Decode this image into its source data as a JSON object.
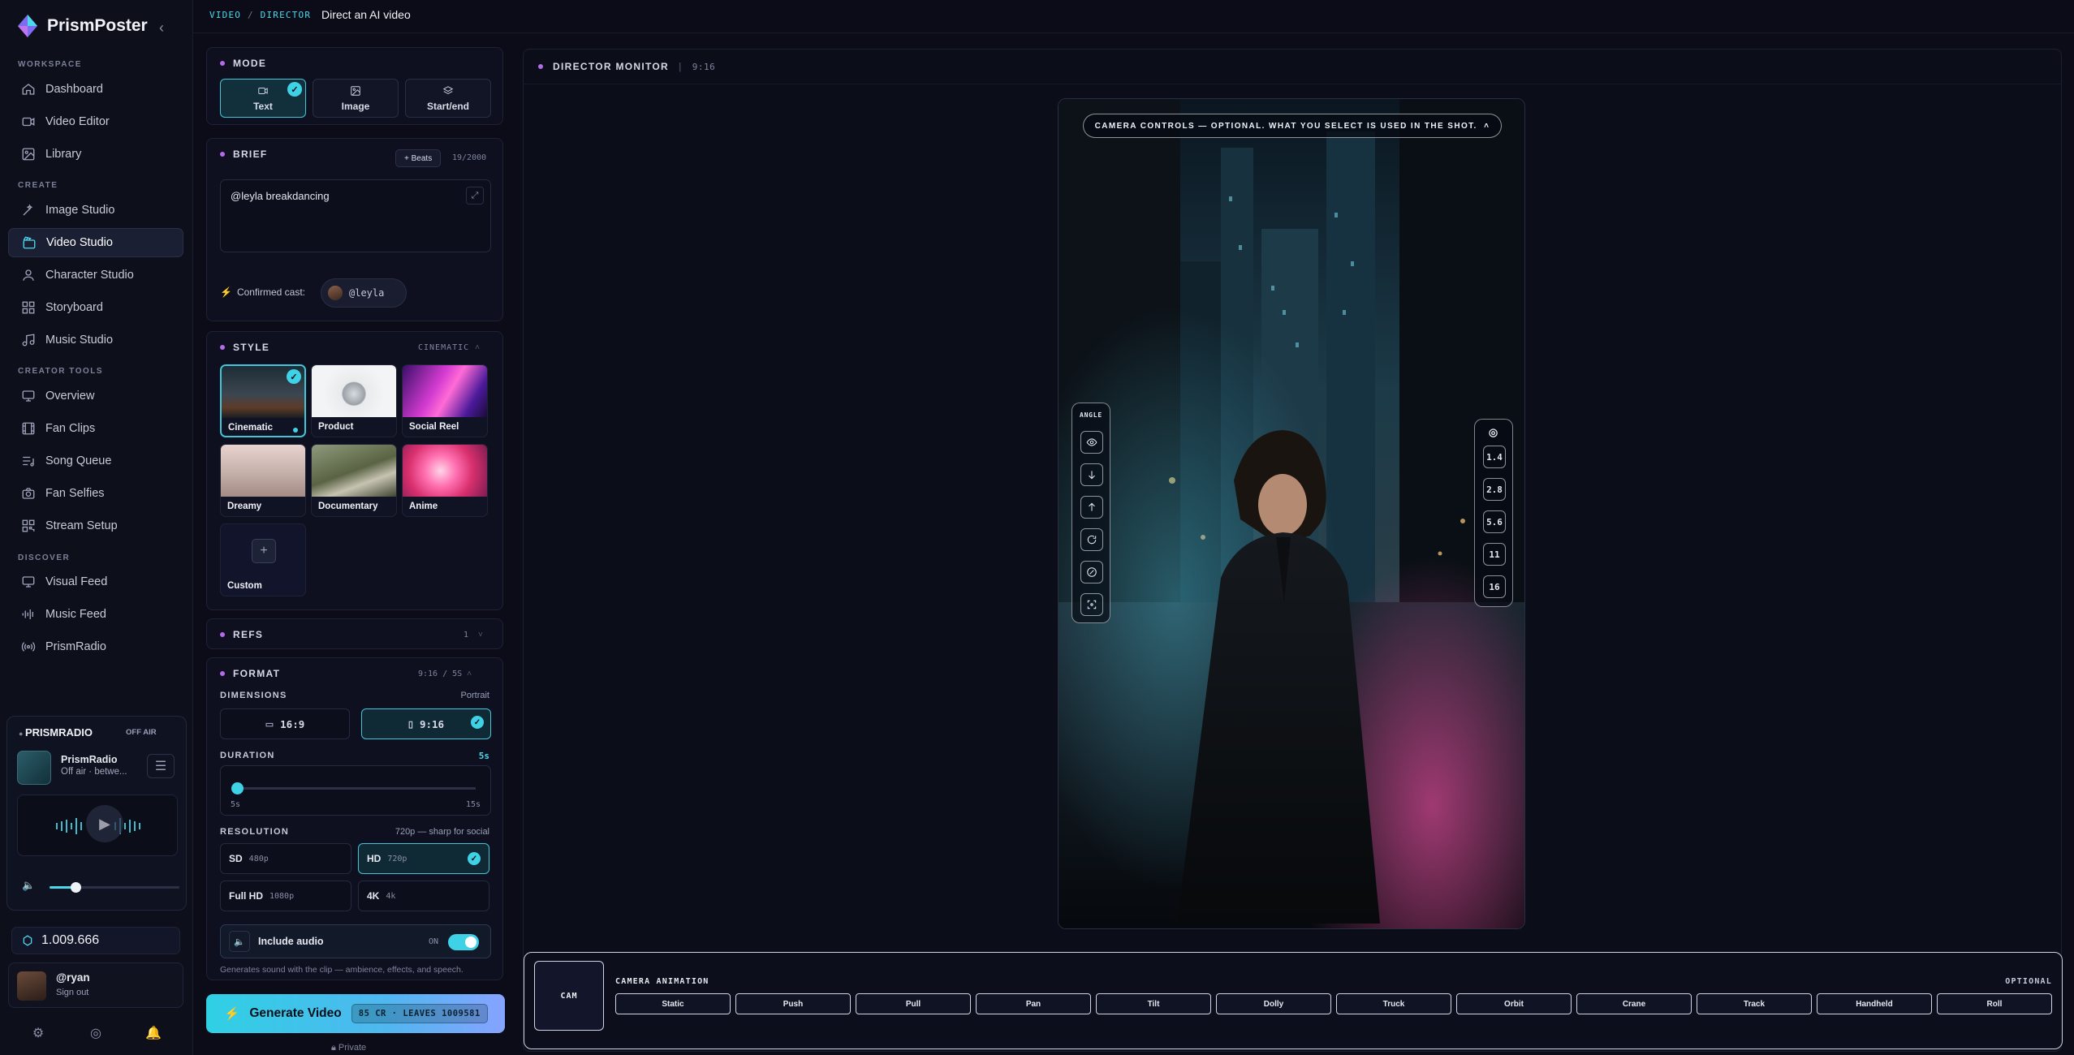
{
  "app": {
    "name": "PrismPoster"
  },
  "breadcrumb": {
    "section": "VIDEO",
    "sep": "/",
    "page": "DIRECTOR",
    "title": "Direct an AI video"
  },
  "sidebar": {
    "sections": {
      "workspace": "WORKSPACE",
      "create": "CREATE",
      "creator_tools": "CREATOR TOOLS",
      "discover": "DISCOVER"
    },
    "items": [
      {
        "label": "Dashboard",
        "icon": "home-icon"
      },
      {
        "label": "Video Editor",
        "icon": "video-icon"
      },
      {
        "label": "Library",
        "icon": "image-icon"
      },
      {
        "label": "Image Studio",
        "icon": "wand-icon"
      },
      {
        "label": "Video Studio",
        "icon": "clapperboard-icon",
        "active": true
      },
      {
        "label": "Character Studio",
        "icon": "user-icon"
      },
      {
        "label": "Storyboard",
        "icon": "grid-icon"
      },
      {
        "label": "Music Studio",
        "icon": "music-icon"
      },
      {
        "label": "Overview",
        "icon": "monitor-icon"
      },
      {
        "label": "Fan Clips",
        "icon": "film-icon"
      },
      {
        "label": "Song Queue",
        "icon": "list-music-icon"
      },
      {
        "label": "Fan Selfies",
        "icon": "camera-icon"
      },
      {
        "label": "Stream Setup",
        "icon": "qr-icon"
      },
      {
        "label": "Visual Feed",
        "icon": "monitor-icon"
      },
      {
        "label": "Music Feed",
        "icon": "waveform-icon"
      },
      {
        "label": "PrismRadio",
        "icon": "radio-icon"
      }
    ],
    "radio": {
      "title": "PRISMRADIO",
      "status": "OFF AIR",
      "station": "PrismRadio",
      "subtitle": "Off air · betwe...",
      "volume": 0.2
    },
    "credits": "1.009.666",
    "user": {
      "name": "@ryan",
      "action": "Sign out"
    }
  },
  "mode": {
    "title": "MODE",
    "options": [
      {
        "label": "Text",
        "selected": true
      },
      {
        "label": "Image"
      },
      {
        "label": "Start/end"
      }
    ]
  },
  "brief": {
    "title": "BRIEF",
    "beats_label": "+ Beats",
    "count": "19/2000",
    "text": "@leyla breakdancing",
    "cast_label": "Confirmed cast:",
    "cast_chip": "@leyla"
  },
  "style": {
    "title": "STYLE",
    "selected_name": "CINEMATIC",
    "tiles": [
      {
        "label": "Cinematic",
        "selected": true
      },
      {
        "label": "Product"
      },
      {
        "label": "Social Reel"
      },
      {
        "label": "Dreamy"
      },
      {
        "label": "Documentary"
      },
      {
        "label": "Anime"
      },
      {
        "label": "Custom"
      }
    ]
  },
  "refs": {
    "title": "REFS",
    "count": "1"
  },
  "format": {
    "title": "FORMAT",
    "summary": "9:16 / 5S",
    "dimensions_label": "DIMENSIONS",
    "orientation": "Portrait",
    "dimensions": [
      {
        "label": "16:9"
      },
      {
        "label": "9:16",
        "selected": true
      }
    ],
    "duration_label": "DURATION",
    "duration_value": "5s",
    "duration_min": "5s",
    "duration_max": "15s",
    "duration_fraction": 0,
    "resolution_label": "RESOLUTION",
    "resolution_note": "720p — sharp for social",
    "resolutions": [
      {
        "label": "SD",
        "px": "480p"
      },
      {
        "label": "HD",
        "px": "720p",
        "selected": true
      },
      {
        "label": "Full HD",
        "px": "1080p"
      },
      {
        "label": "4K",
        "px": "4k"
      }
    ],
    "audio_label": "Include audio",
    "audio_state": "ON",
    "audio_note": "Generates sound with the clip — ambience, effects, and speech."
  },
  "generate": {
    "label": "Generate Video",
    "cost": "85 CR · LEAVES 1009581",
    "visibility": "Private"
  },
  "monitor": {
    "title": "DIRECTOR MONITOR",
    "ratio": "9:16",
    "camera_controls": "CAMERA CONTROLS — OPTIONAL. WHAT YOU SELECT IS USED IN THE SHOT.",
    "angle_label": "ANGLE",
    "angles": [
      "eye-level-icon",
      "low-angle-icon",
      "high-angle-icon",
      "rotate-icon",
      "dutch-angle-icon",
      "focus-icon"
    ],
    "apertures": [
      "1.4",
      "2.8",
      "5.6",
      "11",
      "16"
    ]
  },
  "animation": {
    "cam_label": "CAM",
    "title": "CAMERA ANIMATION",
    "optional": "OPTIONAL",
    "moves": [
      "Static",
      "Push",
      "Pull",
      "Pan",
      "Tilt",
      "Dolly",
      "Truck",
      "Orbit",
      "Crane",
      "Track",
      "Handheld",
      "Roll"
    ]
  },
  "colors": {
    "accent": "#3fd2e6",
    "purple_dot": "#b46be8",
    "bg": "#0b0c17"
  }
}
